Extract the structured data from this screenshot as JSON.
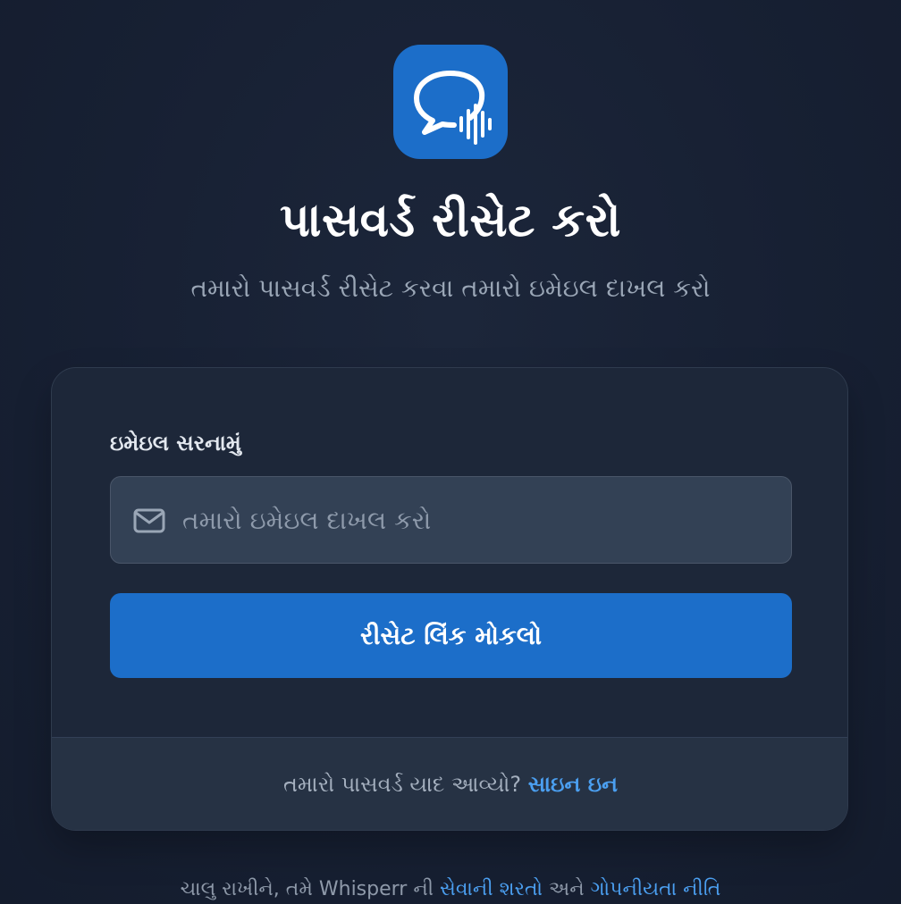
{
  "app": {
    "logo_icon": "chat-bubble-soundwave-icon",
    "accent_color": "#1c6ec9",
    "link_color": "#4b9ff0"
  },
  "header": {
    "title": "પાસવર્ડ રીસેટ કરો",
    "subtitle": "તમારો પાસવર્ડ રીસેટ કરવા તમારો ઇમેઇલ દાખલ કરો"
  },
  "form": {
    "email_label": "ઇમેઇલ સરનામું",
    "email_placeholder": "તમારો ઇમેઇલ દાખલ કરો",
    "email_value": "",
    "email_icon": "mail-icon",
    "submit_label": "રીસેટ લિંક મોકલો"
  },
  "card_footer": {
    "prompt": "તમારો પાસવર્ડ યાદ આવ્યો? ",
    "signin_link": "સાઇન ઇન"
  },
  "legal": {
    "prefix": "ચાલુ રાખીને, તમે Whisperr ની ",
    "terms_link": "સેવાની શરતો",
    "conjunction": " અને ",
    "privacy_link": "ગોપનીયતા નીતિ"
  }
}
